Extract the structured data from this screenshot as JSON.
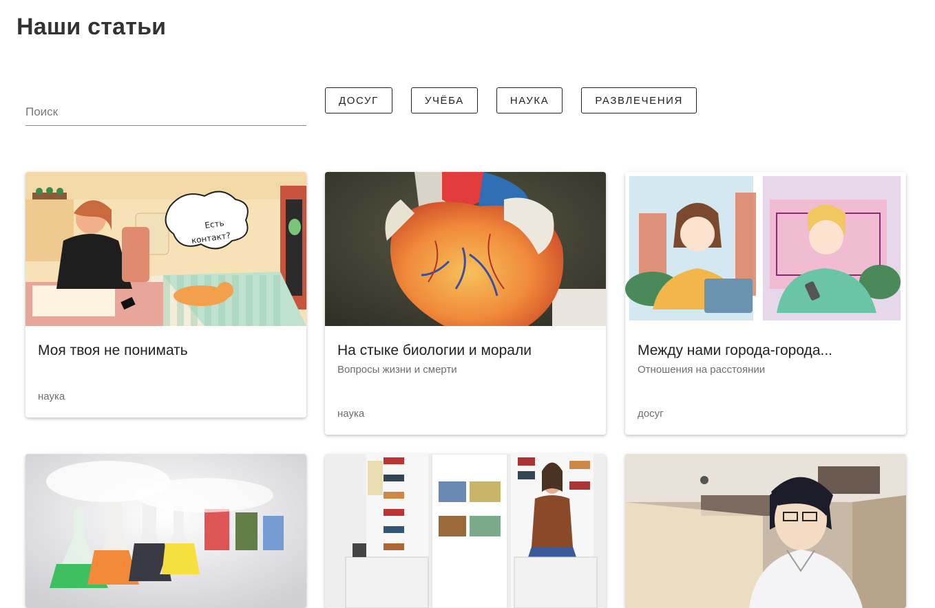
{
  "page": {
    "title": "Наши статьи"
  },
  "search": {
    "placeholder": "Поиск"
  },
  "filters": [
    "ДОСУГ",
    "УЧЁБА",
    "НАУКА",
    "РАЗВЛЕЧЕНИЯ"
  ],
  "cards": [
    {
      "title": "Моя твоя не понимать",
      "subtitle": "",
      "tag": "наука",
      "image": "illustration-alien-contact",
      "bubble": "Есть контакт?"
    },
    {
      "title": "На стыке биологии и морали",
      "subtitle": "Вопросы жизни и смерти",
      "tag": "наука",
      "image": "photo-heart-model"
    },
    {
      "title": "Между нами города-города...",
      "subtitle": "Отношения на расстоянии",
      "tag": "досуг",
      "image": "illustration-long-distance-couple"
    },
    {
      "title": "",
      "subtitle": "",
      "tag": "",
      "image": "photo-chemistry-flasks"
    },
    {
      "title": "",
      "subtitle": "",
      "tag": "",
      "image": "photo-man-with-bookshelves"
    },
    {
      "title": "",
      "subtitle": "",
      "tag": "",
      "image": "illustration-anime-character"
    }
  ],
  "colors": {
    "chip_border": "#222222",
    "text_secondary": "#6d6d6d",
    "title": "#333333"
  }
}
